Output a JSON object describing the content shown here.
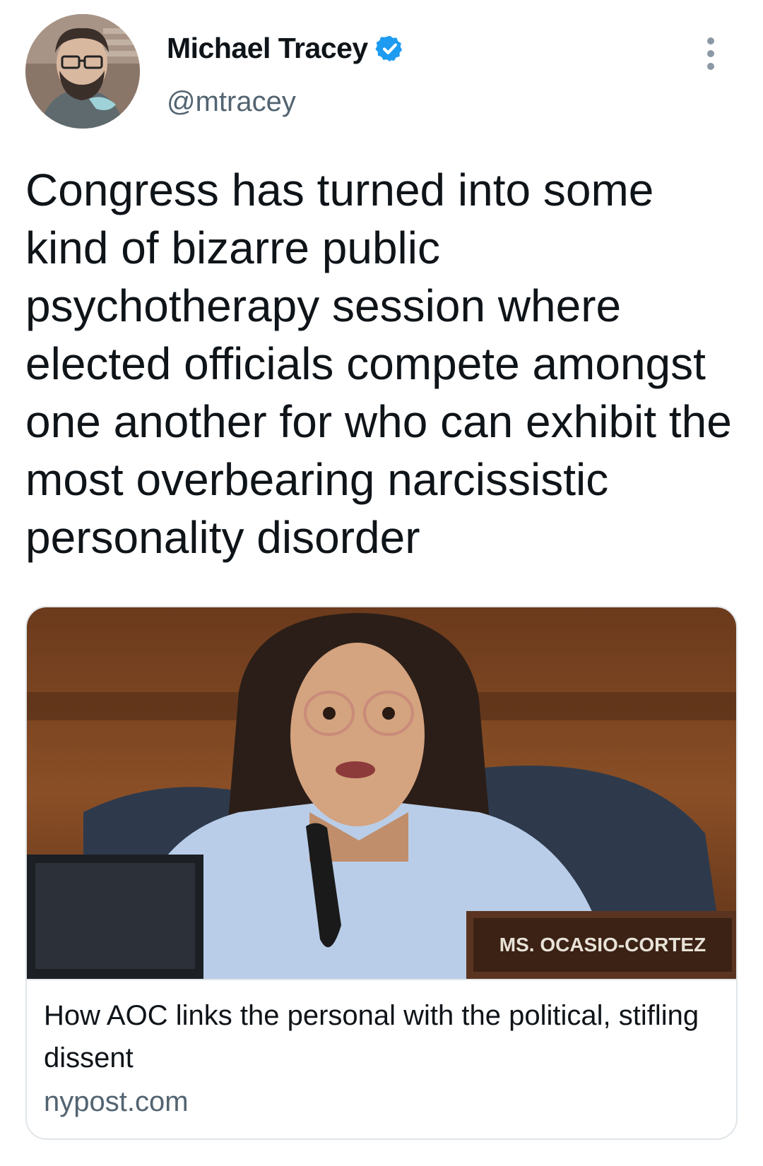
{
  "author": {
    "name": "Michael Tracey",
    "handle": "@mtracey",
    "verified_icon": "verified-badge-icon",
    "verified_color": "#1d9bf0"
  },
  "tweet": {
    "text": "Congress has turned into some kind of bizarre public psychotherapy session where elected officials compete amongst one another for who can exhibit the most overbearing narcissistic personality disorder"
  },
  "link_card": {
    "image_nameplate": "MS. OCASIO-CORTEZ",
    "title": "How AOC links the personal with the political, stifling dissent",
    "domain": "nypost.com"
  },
  "colors": {
    "text": "#0f1419",
    "secondary": "#536471",
    "border": "#e1e6ea"
  }
}
